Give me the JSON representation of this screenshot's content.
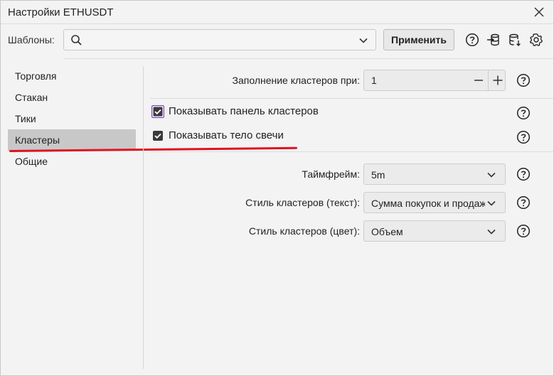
{
  "window": {
    "title": "Настройки ETHUSDT"
  },
  "toolbar": {
    "templates_label": "Шаблоны:",
    "search": {
      "value": "",
      "placeholder": ""
    },
    "apply_label": "Применить",
    "icons": [
      "help-icon",
      "import-icon",
      "database-download-icon",
      "settings-icon"
    ]
  },
  "sidebar": {
    "items": [
      {
        "label": "Торговля",
        "active": false
      },
      {
        "label": "Стакан",
        "active": false
      },
      {
        "label": "Тики",
        "active": false
      },
      {
        "label": "Кластеры",
        "active": true
      },
      {
        "label": "Общие",
        "active": false
      }
    ]
  },
  "settings": {
    "fill_label": "Заполнение кластеров при:",
    "fill_value": "1",
    "show_panel": {
      "label": "Показывать панель кластеров",
      "checked": true
    },
    "show_body": {
      "label": "Показывать тело свечи",
      "checked": true
    },
    "timeframe": {
      "label": "Таймфрейм:",
      "value": "5m"
    },
    "style_text": {
      "label": "Стиль кластеров (текст):",
      "value": "Сумма покупок и продаж"
    },
    "style_color": {
      "label": "Стиль кластеров (цвет):",
      "value": "Объем"
    }
  },
  "colors": {
    "checkbox": "#3a3a3a",
    "checkbox_focus": "#7b3fc4",
    "annotation": "#e0121f",
    "active_item": "#c8c8c8"
  }
}
